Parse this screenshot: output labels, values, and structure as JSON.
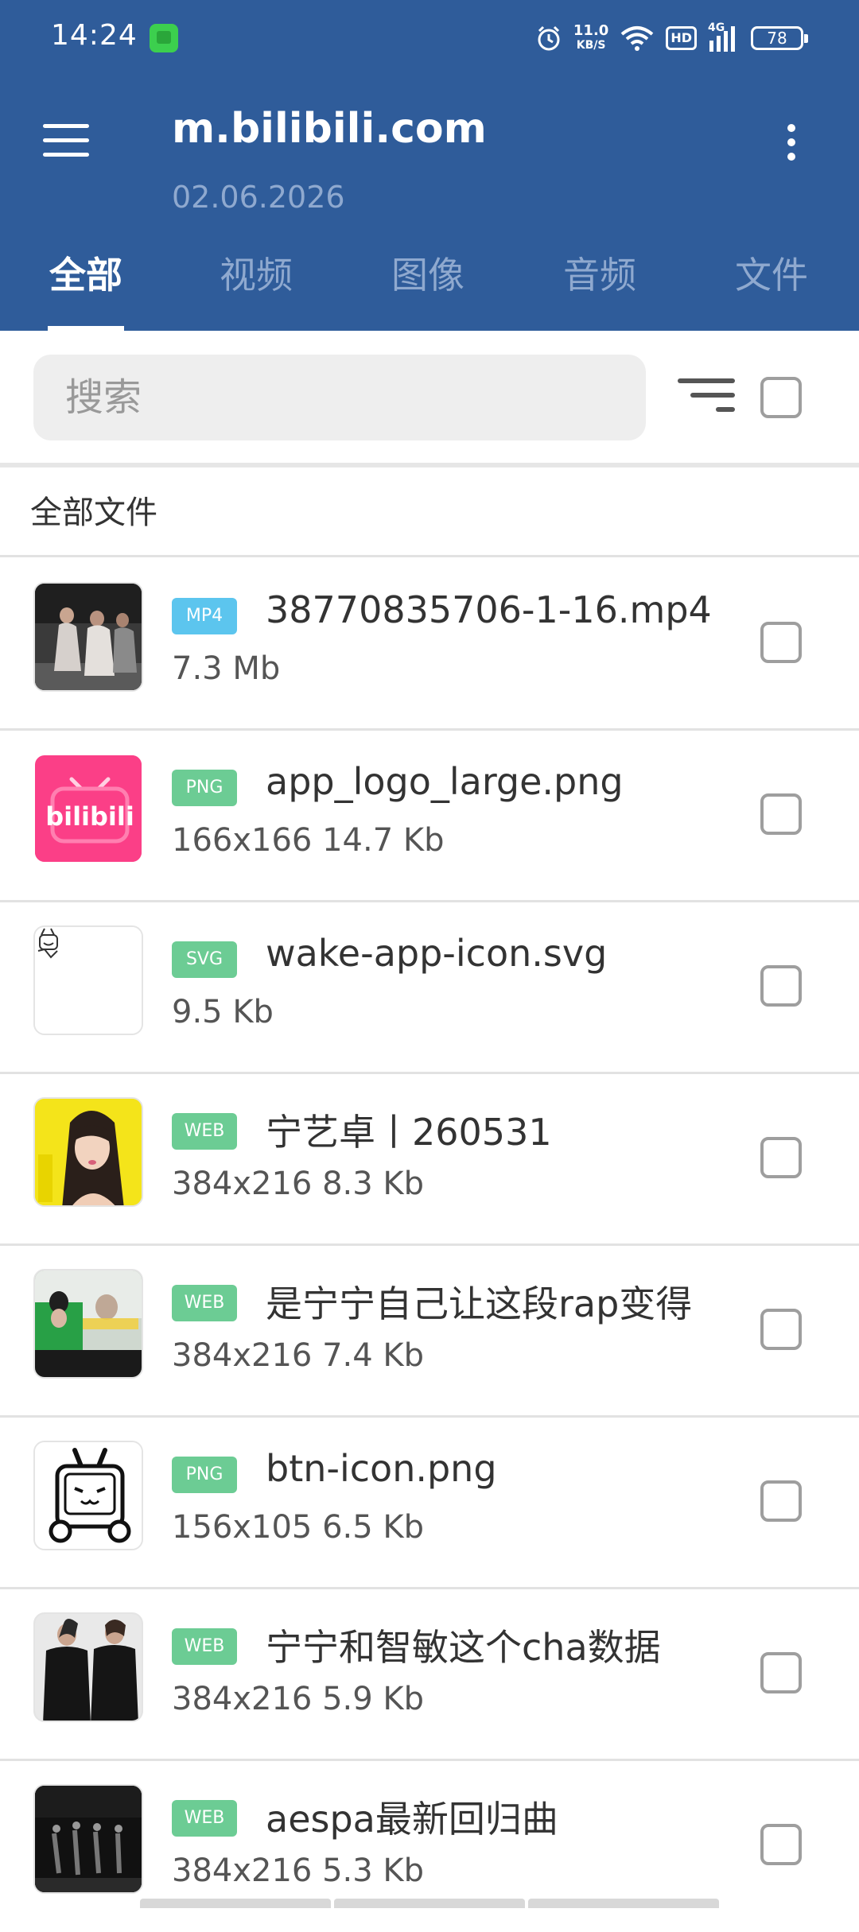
{
  "status_bar": {
    "time": "14:24",
    "net_speed": "11.0",
    "net_unit": "KB/S",
    "hd": "HD",
    "net_type": "4G",
    "battery": "78"
  },
  "header": {
    "title": "m.bilibili.com",
    "date": "02.06.2026"
  },
  "tabs": [
    {
      "label": "全部",
      "active": true
    },
    {
      "label": "视频",
      "active": false
    },
    {
      "label": "图像",
      "active": false
    },
    {
      "label": "音频",
      "active": false
    },
    {
      "label": "文件",
      "active": false
    }
  ],
  "search": {
    "placeholder": "搜索",
    "value": ""
  },
  "section_title": "全部文件",
  "files": [
    {
      "type": "MP4",
      "name": "38770835706-1-16.mp4",
      "meta": "7.3 Mb",
      "thumb": "dance-video"
    },
    {
      "type": "PNG",
      "name": "app_logo_large.png",
      "meta": "166x166 14.7 Kb",
      "thumb": "bilibili-logo"
    },
    {
      "type": "SVG",
      "name": "wake-app-icon.svg",
      "meta": "9.5 Kb",
      "thumb": "mascot-sketch"
    },
    {
      "type": "WEB",
      "name": "宁艺卓丨260531",
      "meta": "384x216 8.3 Kb",
      "thumb": "yellow-portrait"
    },
    {
      "type": "WEB",
      "name": "是宁宁自己让这段rap变得",
      "meta": "384x216 7.4 Kb",
      "thumb": "stage-clip"
    },
    {
      "type": "PNG",
      "name": "btn-icon.png",
      "meta": "156x105 6.5 Kb",
      "thumb": "tv-mascot"
    },
    {
      "type": "WEB",
      "name": "宁宁和智敏这个cha数据",
      "meta": "384x216 5.9 Kb",
      "thumb": "two-dancers"
    },
    {
      "type": "WEB",
      "name": "aespa最新回归曲",
      "meta": "384x216 5.3 Kb",
      "thumb": "dark-stage"
    }
  ],
  "colors": {
    "header_bg": "#2f5c9a",
    "tab_inactive": "#8fa9cf",
    "badge_video": "#5cc5ee",
    "badge_other": "#6ccc94",
    "bilibili_pink": "#fb3f87"
  }
}
